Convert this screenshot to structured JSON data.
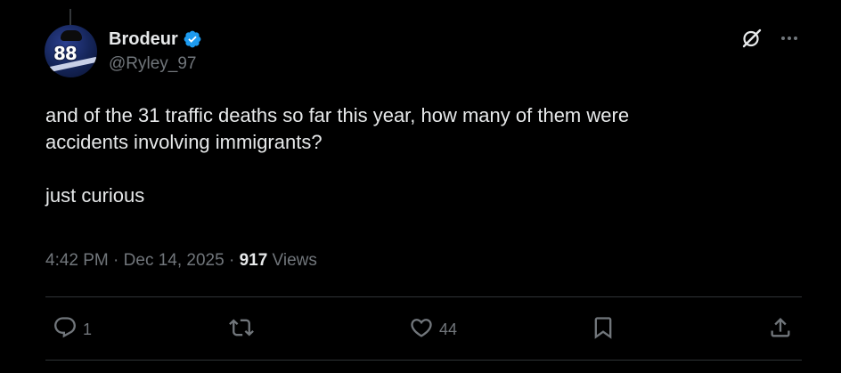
{
  "author": {
    "display_name": "Brodeur",
    "handle": "@Ryley_97",
    "avatar_number": "88"
  },
  "tweet": {
    "text": "and of the 31 traffic deaths so far this year, how many of them were\naccidents involving immigrants?\n\njust curious"
  },
  "meta": {
    "time": "4:42 PM",
    "separator": " · ",
    "date": "Dec 14, 2025",
    "views_count": "917",
    "views_label": " Views"
  },
  "actions": {
    "reply_count": "1",
    "retweet_count": "",
    "like_count": "44"
  },
  "colors": {
    "background": "#000000",
    "text": "#e7e9ea",
    "muted": "#71767b",
    "verified": "#1d9bf0",
    "divider": "#2f3336"
  },
  "icons": [
    "verified-badge-icon",
    "grok-icon",
    "more-icon",
    "reply-icon",
    "retweet-icon",
    "like-icon",
    "bookmark-icon",
    "share-icon"
  ]
}
